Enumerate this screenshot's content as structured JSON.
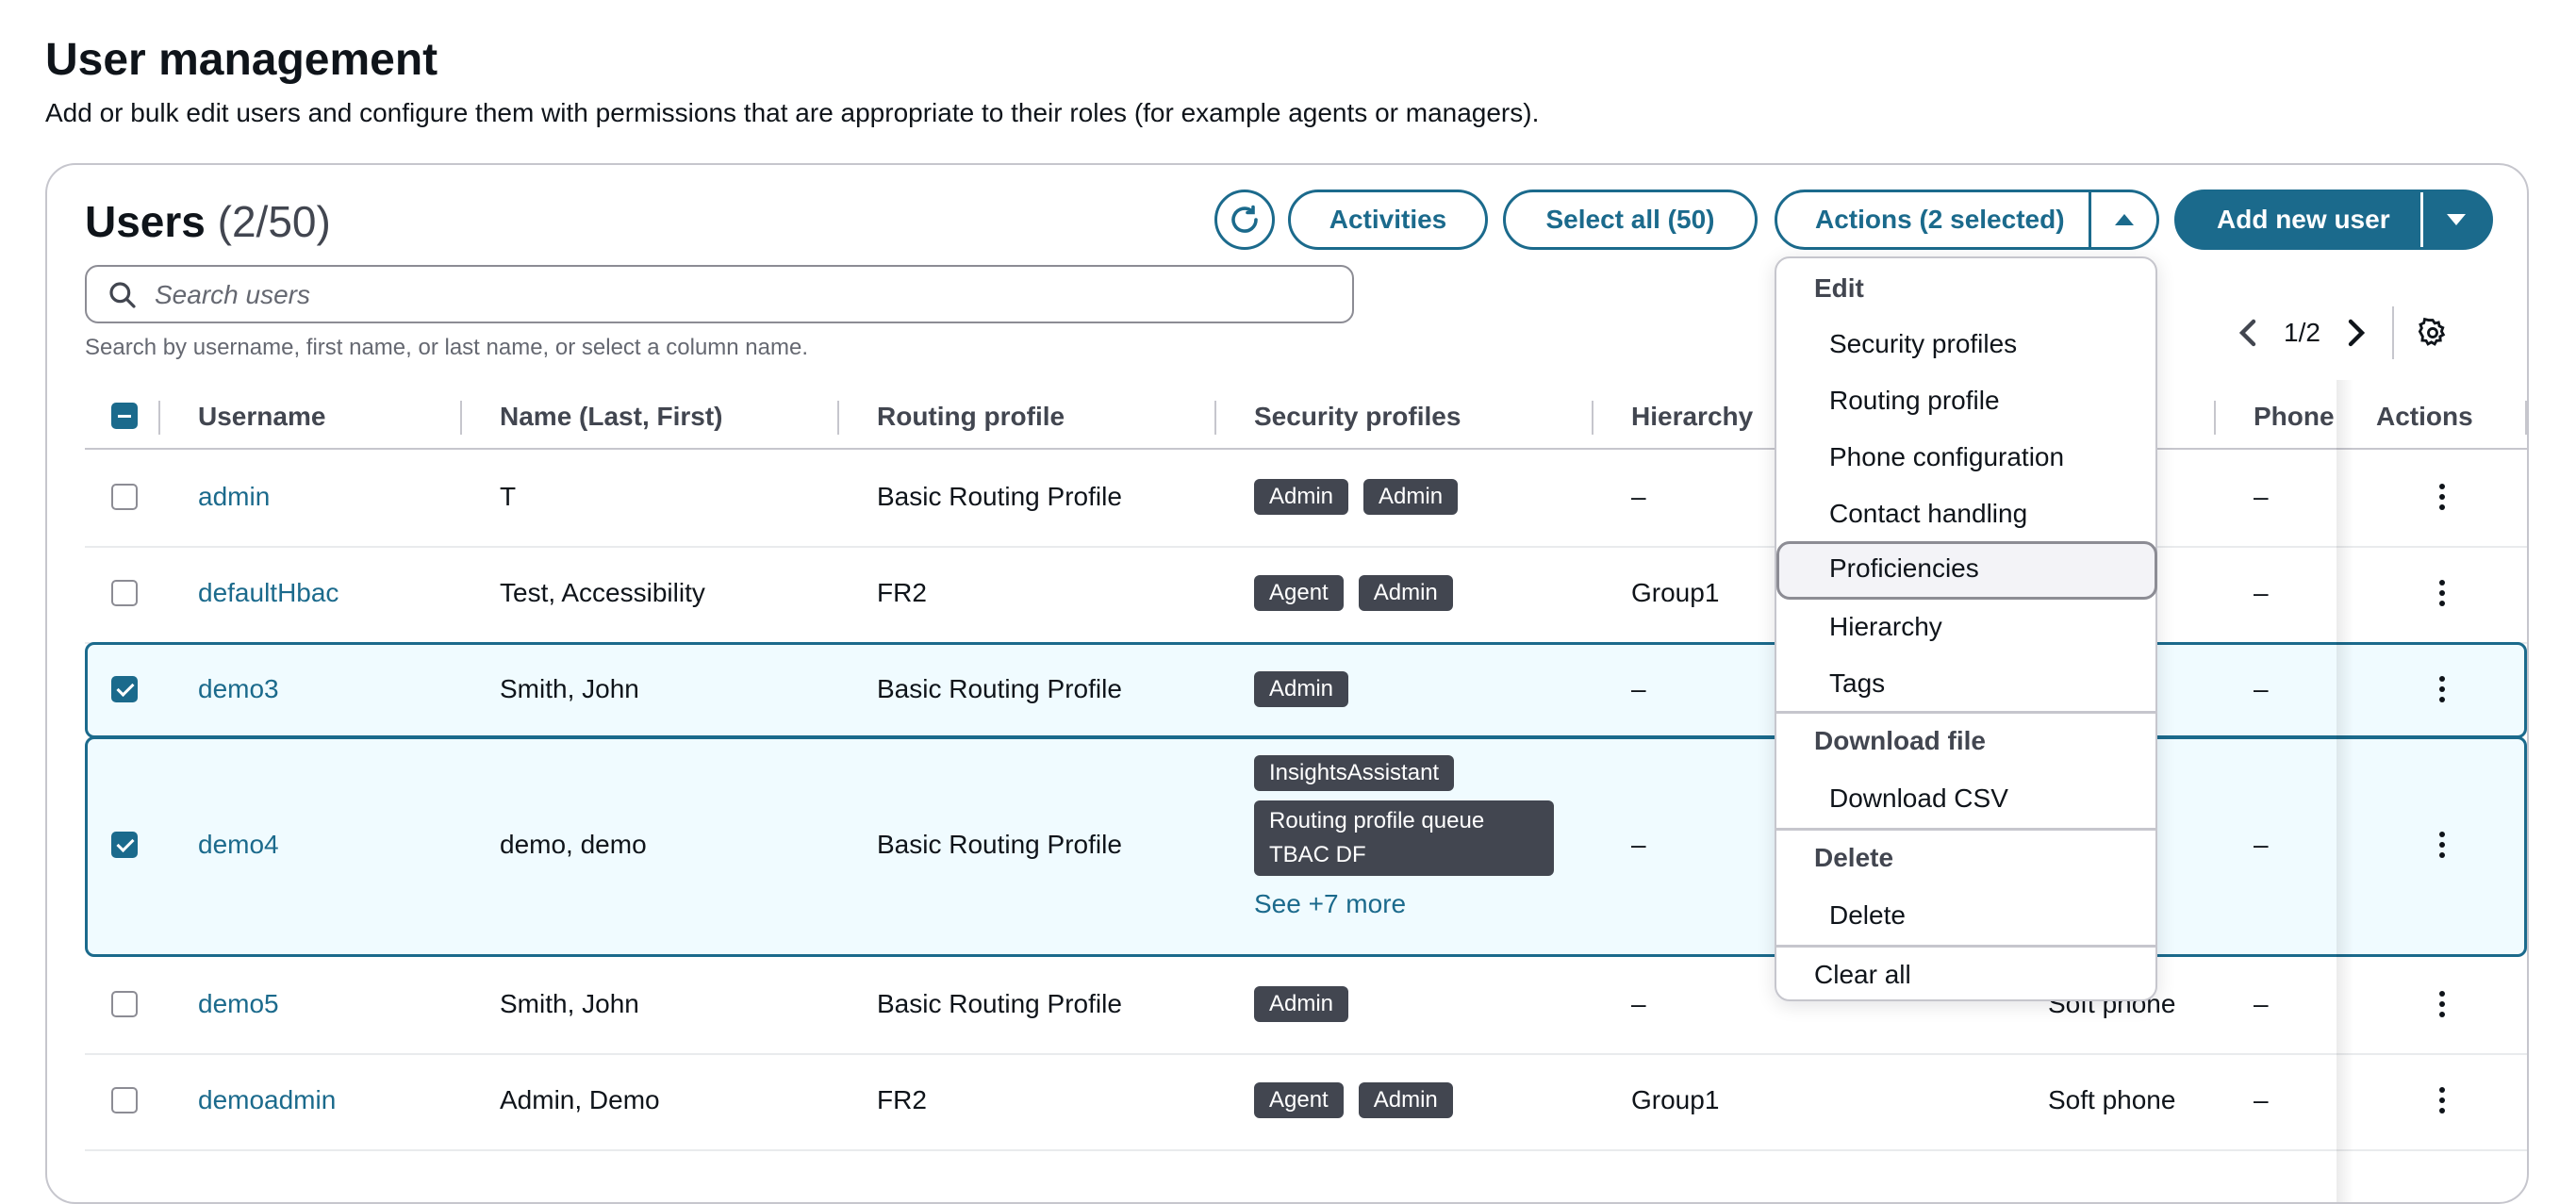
{
  "page": {
    "title": "User management",
    "description": "Add or bulk edit users and configure them with permissions that are appropriate to their roles (for example agents or managers)."
  },
  "panel": {
    "title": "Users",
    "count": "(2/50)",
    "buttons": {
      "activities": "Activities",
      "select_all": "Select all (50)",
      "actions": "Actions (2 selected)",
      "add_new_user": "Add new user"
    },
    "search": {
      "placeholder": "Search users",
      "value": "",
      "hint": "Search by username, first name, or last name, or select a column name."
    },
    "pagination": {
      "page": "1/2"
    }
  },
  "table": {
    "columns": [
      "Username",
      "Name (Last, First)",
      "Routing profile",
      "Security profiles",
      "Hierarchy",
      "Phone",
      "Actions"
    ],
    "rows": [
      {
        "username": "admin",
        "name": "T",
        "routing": "Basic Routing Profile",
        "badges": [
          "Admin",
          "Admin"
        ],
        "hierarchy": "–",
        "phone_type": "",
        "phone": "–",
        "selected": false
      },
      {
        "username": "defaultHbac",
        "name": "Test, Accessibility",
        "routing": "FR2",
        "badges": [
          "Agent",
          "Admin"
        ],
        "hierarchy": "Group1",
        "phone_type": "",
        "phone": "–",
        "selected": false
      },
      {
        "username": "demo3",
        "name": "Smith, John",
        "routing": "Basic Routing Profile",
        "badges": [
          "Admin"
        ],
        "hierarchy": "–",
        "phone_type": "",
        "phone": "–",
        "selected": true
      },
      {
        "username": "demo4",
        "name": "demo, demo",
        "routing": "Basic Routing Profile",
        "badges": [
          "InsightsAssistant",
          "Routing profile queue TBAC DF"
        ],
        "see_more": "See +7 more",
        "hierarchy": "–",
        "phone_type": "",
        "phone": "–",
        "selected": true
      },
      {
        "username": "demo5",
        "name": "Smith, John",
        "routing": "Basic Routing Profile",
        "badges": [
          "Admin"
        ],
        "hierarchy": "–",
        "phone_type": "Soft phone",
        "phone": "–",
        "selected": false
      },
      {
        "username": "demoadmin",
        "name": "Admin, Demo",
        "routing": "FR2",
        "badges": [
          "Agent",
          "Admin"
        ],
        "hierarchy": "Group1",
        "phone_type": "Soft phone",
        "phone": "–",
        "selected": false
      }
    ]
  },
  "actions_menu": {
    "groups": [
      {
        "label": "Edit",
        "items": [
          "Security profiles",
          "Routing profile",
          "Phone configuration",
          "Contact handling",
          "Proficiencies",
          "Hierarchy",
          "Tags"
        ]
      },
      {
        "label": "Download file",
        "items": [
          "Download CSV"
        ]
      },
      {
        "label": "Delete",
        "items": [
          "Delete"
        ]
      }
    ],
    "clear_all": "Clear all",
    "hovered_item": "Proficiencies"
  },
  "colors": {
    "link": "#1b6a8c",
    "primary": "#1b6a8c",
    "selected_row_bg": "#f0fbff",
    "badge_bg": "#424650"
  },
  "icons": [
    "refresh-icon",
    "chevron-up-icon",
    "caret-down-icon",
    "search-icon",
    "chevron-left-icon",
    "chevron-right-icon",
    "gear-icon",
    "kebab-icon"
  ]
}
